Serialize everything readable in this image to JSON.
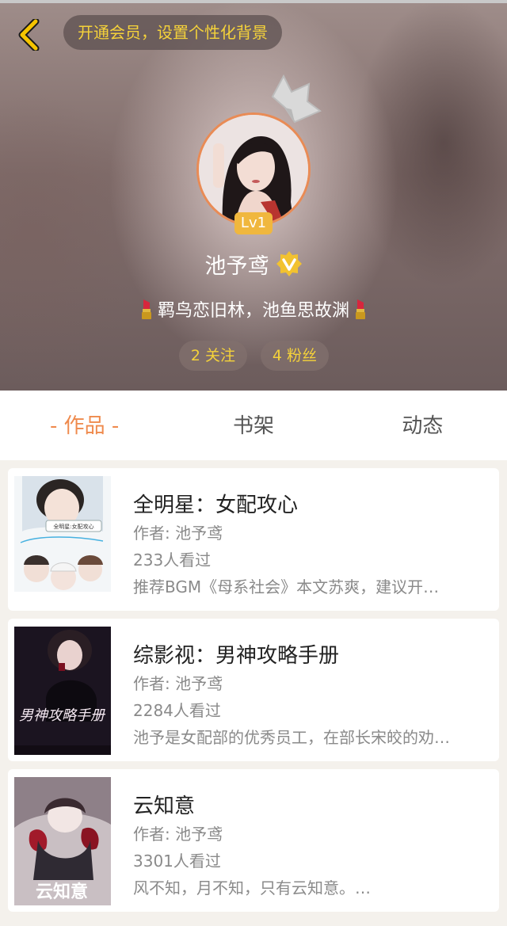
{
  "header": {
    "vip_prompt": "开通会员，设置个性化背景",
    "level": "Lv1",
    "username": "池予鸢",
    "bio": "羁鸟恋旧林，池鱼思故渊",
    "following": "2 关注",
    "followers": "4 粉丝"
  },
  "tabs": [
    {
      "label": "- 作品 -",
      "active": true
    },
    {
      "label": "书架",
      "active": false
    },
    {
      "label": "动态",
      "active": false
    }
  ],
  "works": [
    {
      "title": "全明星：女配攻心",
      "author": "作者: 池予鸢",
      "views": "233人看过",
      "desc": "推荐BGM《母系社会》本文苏爽，建议开…",
      "cover_text": "全明星:女配攻心"
    },
    {
      "title": "综影视：男神攻略手册",
      "author": "作者: 池予鸢",
      "views": "2284人看过",
      "desc": "池予是女配部的优秀员工，在部长宋皎的劝…",
      "cover_text": "男神攻略手册"
    },
    {
      "title": "云知意",
      "author": "作者: 池予鸢",
      "views": "3301人看过",
      "desc": "风不知，月不知，只有云知意。…",
      "cover_text": "云知意"
    }
  ],
  "colors": {
    "accent": "#ef8a4d",
    "gold": "#f5d23a",
    "avatar_ring": "#e98b55",
    "level_badge": "#f0b73e"
  }
}
